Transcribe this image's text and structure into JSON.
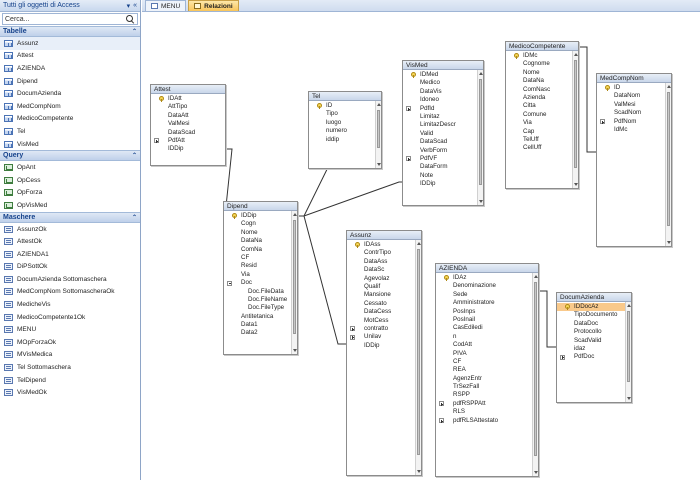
{
  "nav": {
    "title": "Tutti gli oggetti di Access",
    "search_placeholder": "Cerca...",
    "groups": [
      {
        "label": "Tabelle",
        "type": "table",
        "items": [
          "Assunz",
          "Attest",
          "AZIENDA",
          "Dipend",
          "DocumAzienda",
          "MedCompNom",
          "MedicoCompetente",
          "Tel",
          "VisMed"
        ]
      },
      {
        "label": "Query",
        "type": "query",
        "items": [
          "OpAnt",
          "OpCess",
          "OpForza",
          "OpVisMed"
        ]
      },
      {
        "label": "Maschere",
        "type": "form",
        "items": [
          "AssunzOk",
          "AttestOk",
          "AZIENDA1",
          "DiPSottOk",
          "DocumAzienda Sottomaschera",
          "MedCompNom SottomascheraOk",
          "MedicheVis",
          "MedicoCompetente1Ok",
          "MENU",
          "MOpForzaOk",
          "MVisMedica",
          "Tel Sottomaschera",
          "TelDipend",
          "VisMedOk"
        ]
      }
    ]
  },
  "tabs": [
    {
      "label": "MENU",
      "active": false
    },
    {
      "label": "Relazioni",
      "active": true
    }
  ],
  "tables": [
    {
      "id": "attest",
      "title": "Attest",
      "scroll": false,
      "fields": [
        {
          "n": "IDAtt",
          "k": true
        },
        {
          "n": "AttTipo"
        },
        {
          "n": "DataAtt"
        },
        {
          "n": "ValMesi"
        },
        {
          "n": "DataScad"
        },
        {
          "n": "PdfAtt",
          "e": "plus"
        },
        {
          "n": "IDDip"
        }
      ]
    },
    {
      "id": "tel",
      "title": "Tel",
      "scroll": true,
      "fields": [
        {
          "n": "ID",
          "k": true
        },
        {
          "n": "Tipo"
        },
        {
          "n": "luogo"
        },
        {
          "n": "numero"
        },
        {
          "n": "iddip"
        }
      ]
    },
    {
      "id": "vismed",
      "title": "VisMed",
      "scroll": true,
      "fields": [
        {
          "n": "IDMed",
          "k": true
        },
        {
          "n": "Medico"
        },
        {
          "n": "DataVis"
        },
        {
          "n": "Idoneo"
        },
        {
          "n": "PdfId",
          "e": "plus"
        },
        {
          "n": "Limitaz"
        },
        {
          "n": "LimitazDescr"
        },
        {
          "n": "Valid"
        },
        {
          "n": "DataScad"
        },
        {
          "n": "VerbForm"
        },
        {
          "n": "PdfVF",
          "e": "plus"
        },
        {
          "n": "DataForm"
        },
        {
          "n": "Note"
        },
        {
          "n": "IDDip"
        }
      ]
    },
    {
      "id": "medicocomp",
      "title": "MedicoCompetente",
      "scroll": true,
      "fields": [
        {
          "n": "IDMc",
          "k": true
        },
        {
          "n": "Cognome"
        },
        {
          "n": "Nome"
        },
        {
          "n": "DataNa"
        },
        {
          "n": "ComNasc"
        },
        {
          "n": "Azienda"
        },
        {
          "n": "Citta"
        },
        {
          "n": "Comune"
        },
        {
          "n": "Via"
        },
        {
          "n": "Cap"
        },
        {
          "n": "TelUff"
        },
        {
          "n": "CellUff"
        }
      ]
    },
    {
      "id": "medcompnom",
      "title": "MedCompNom",
      "scroll": true,
      "fields": [
        {
          "n": "ID",
          "k": true
        },
        {
          "n": "DataNom"
        },
        {
          "n": "ValMesi"
        },
        {
          "n": "ScadNom"
        },
        {
          "n": "PdfNom",
          "e": "plus"
        },
        {
          "n": "IdMc"
        }
      ]
    },
    {
      "id": "dipend",
      "title": "Dipend",
      "scroll": true,
      "fields": [
        {
          "n": "IDDip",
          "k": true
        },
        {
          "n": "Cogn"
        },
        {
          "n": "Nome"
        },
        {
          "n": "DataNa"
        },
        {
          "n": "ComNa"
        },
        {
          "n": "CF"
        },
        {
          "n": "Resid"
        },
        {
          "n": "Via"
        },
        {
          "n": "Doc",
          "e": "minus"
        },
        {
          "n": "Doc.FileData",
          "i": true
        },
        {
          "n": "Doc.FileName",
          "i": true
        },
        {
          "n": "Doc.FileType",
          "i": true
        },
        {
          "n": "Antitetanica"
        },
        {
          "n": "Data1"
        },
        {
          "n": "Data2"
        }
      ]
    },
    {
      "id": "assunz",
      "title": "Assunz",
      "scroll": true,
      "fields": [
        {
          "n": "IDAss",
          "k": true
        },
        {
          "n": "ContrTipo"
        },
        {
          "n": "DataAss"
        },
        {
          "n": "DataSc"
        },
        {
          "n": "Agevolaz"
        },
        {
          "n": "Qualif"
        },
        {
          "n": "Mansione"
        },
        {
          "n": "Cessato"
        },
        {
          "n": "DataCess"
        },
        {
          "n": "MotCess"
        },
        {
          "n": "contratto",
          "e": "plus"
        },
        {
          "n": "Unilav",
          "e": "plus"
        },
        {
          "n": "IDDip"
        }
      ]
    },
    {
      "id": "azienda",
      "title": "AZIENDA",
      "scroll": true,
      "fields": [
        {
          "n": "IDAz",
          "k": true
        },
        {
          "n": "Denominazione"
        },
        {
          "n": "Sede"
        },
        {
          "n": "Amministratore"
        },
        {
          "n": "PosInps"
        },
        {
          "n": "PosInail"
        },
        {
          "n": "CasEdiledi"
        },
        {
          "n": "n"
        },
        {
          "n": "CodAtt"
        },
        {
          "n": "PIVA"
        },
        {
          "n": "CF"
        },
        {
          "n": "REA"
        },
        {
          "n": "AgenzEntr"
        },
        {
          "n": "TrSezFall"
        },
        {
          "n": "RSPP"
        },
        {
          "n": "pdfRSPPAtt",
          "e": "plus"
        },
        {
          "n": "RLS"
        },
        {
          "n": "pdfRLSAttestato",
          "e": "plus"
        }
      ]
    },
    {
      "id": "documaz",
      "title": "DocumAzienda",
      "scroll": true,
      "fields": [
        {
          "n": "IDDocAz",
          "k": true,
          "h": true
        },
        {
          "n": "TipoDocumento"
        },
        {
          "n": "DataDoc"
        },
        {
          "n": "Protocollo"
        },
        {
          "n": "ScadValid"
        },
        {
          "n": "idaz"
        },
        {
          "n": "PdfDoc",
          "e": "plus"
        }
      ]
    }
  ]
}
